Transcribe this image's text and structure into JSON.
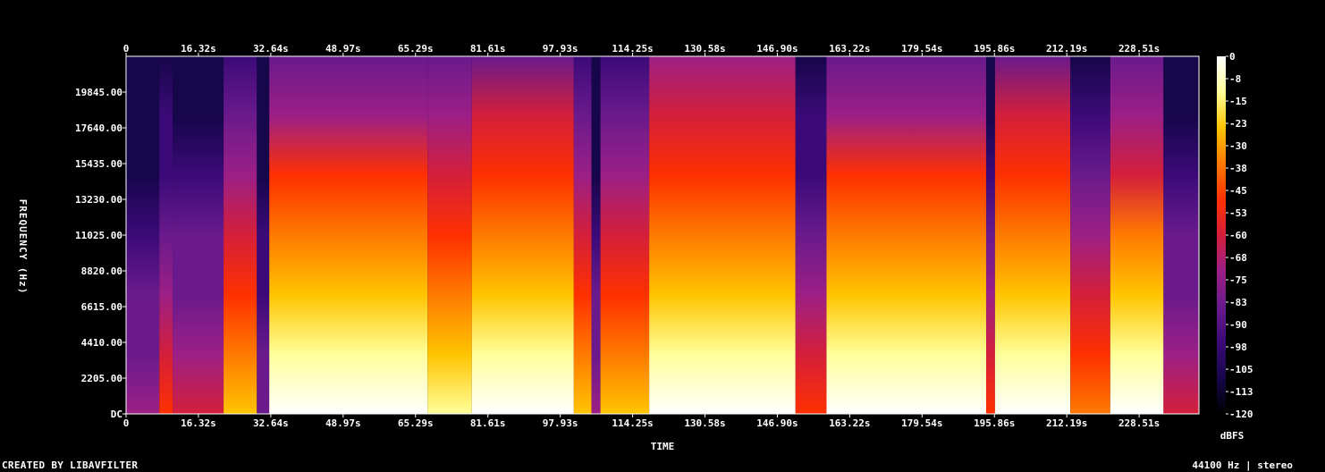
{
  "chart_data": {
    "type": "heatmap",
    "title": "",
    "xlabel": "TIME",
    "ylabel": "FREQUENCY (Hz)",
    "x_ticks": [
      "0",
      "16.32s",
      "32.64s",
      "48.97s",
      "65.29s",
      "81.61s",
      "97.93s",
      "114.25s",
      "130.58s",
      "146.90s",
      "163.22s",
      "179.54s",
      "195.86s",
      "212.19s",
      "228.51s"
    ],
    "x_tick_step_seconds": 16.3225,
    "x_range": [
      0,
      242
    ],
    "y_ticks": [
      "DC",
      "2205.00",
      "4410.00",
      "6615.00",
      "8820.00",
      "11025.00",
      "13230.00",
      "15435.00",
      "17640.00",
      "19845.00"
    ],
    "y_tick_step_hz": 2205,
    "y_range": [
      0,
      22050
    ],
    "colorbar": {
      "label": "dBFS",
      "ticks": [
        "0",
        "-8",
        "-15",
        "-23",
        "-30",
        "-38",
        "-45",
        "-53",
        "-60",
        "-68",
        "-75",
        "-83",
        "-90",
        "-98",
        "-105",
        "-113",
        "-120"
      ],
      "range": [
        -120,
        0
      ],
      "colors": [
        "#000000",
        "#16064a",
        "#3c0a78",
        "#6a1a8c",
        "#9c1f86",
        "#d41f3a",
        "#ff3000",
        "#ff7a00",
        "#ffc400",
        "#ffff9a",
        "#ffffff"
      ]
    },
    "segments": [
      {
        "start": 0,
        "end": 7.5,
        "level": 0.22
      },
      {
        "start": 7.5,
        "end": 10.5,
        "level": 0.42
      },
      {
        "start": 10.5,
        "end": 22,
        "level": 0.33
      },
      {
        "start": 22,
        "end": 29.5,
        "level": 0.62
      },
      {
        "start": 29.5,
        "end": 32.3,
        "level": 0.12
      },
      {
        "start": 32.3,
        "end": 68,
        "level": 0.78
      },
      {
        "start": 68,
        "end": 78,
        "level": 0.72
      },
      {
        "start": 78,
        "end": 101,
        "level": 0.8
      },
      {
        "start": 101,
        "end": 105,
        "level": 0.62
      },
      {
        "start": 105,
        "end": 107,
        "level": 0.22
      },
      {
        "start": 107,
        "end": 118,
        "level": 0.62
      },
      {
        "start": 118,
        "end": 151,
        "level": 0.82
      },
      {
        "start": 151,
        "end": 158,
        "level": 0.42
      },
      {
        "start": 158,
        "end": 194,
        "level": 0.78
      },
      {
        "start": 194,
        "end": 196,
        "level": 0.35
      },
      {
        "start": 196,
        "end": 213,
        "level": 0.8
      },
      {
        "start": 213,
        "end": 222,
        "level": 0.45
      },
      {
        "start": 222,
        "end": 234,
        "level": 0.75
      },
      {
        "start": 234,
        "end": 242,
        "level": 0.32
      }
    ]
  },
  "footer": {
    "left": "CREATED BY LIBAVFILTER",
    "right": "44100 Hz | stereo"
  }
}
